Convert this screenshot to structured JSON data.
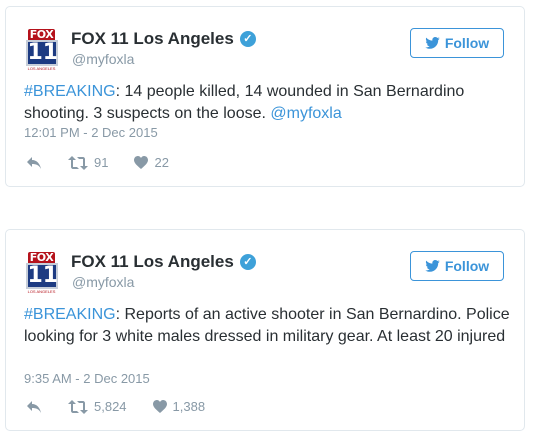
{
  "tweets": [
    {
      "author": {
        "name": "FOX 11 Los Angeles",
        "handle": "@myfoxla",
        "logo_top": "FOX",
        "logo_number": "11",
        "logo_sub": "LOS ANGELES"
      },
      "follow_label": "Follow",
      "text": {
        "hashtag": "#BREAKING",
        "body": ": 14 people killed, 14 wounded in San Bernardino shooting. 3 suspects on the loose. ",
        "mention": "@myfoxla"
      },
      "timestamp": "12:01 PM - 2 Dec 2015",
      "retweets": "91",
      "likes": "22"
    },
    {
      "author": {
        "name": "FOX 11 Los Angeles",
        "handle": "@myfoxla",
        "logo_top": "FOX",
        "logo_number": "11",
        "logo_sub": "LOS ANGELES"
      },
      "follow_label": "Follow",
      "text": {
        "hashtag": "#BREAKING",
        "body": ": Reports of an active shooter in San Bernardino. Police looking for 3 white males dressed in military gear. At least 20 injured",
        "mention": ""
      },
      "timestamp": "9:35 AM - 2 Dec 2015",
      "retweets": "5,824",
      "likes": "1,388"
    }
  ],
  "colors": {
    "accent": "#3b94d9",
    "muted": "#8899a6",
    "text": "#292f33",
    "verified": "#3ea1d9",
    "fox_red": "#b5121b",
    "fox_blue": "#1d3b82"
  },
  "icons": [
    "twitter-bird-icon",
    "verified-badge-icon",
    "reply-icon",
    "retweet-icon",
    "like-heart-icon"
  ]
}
